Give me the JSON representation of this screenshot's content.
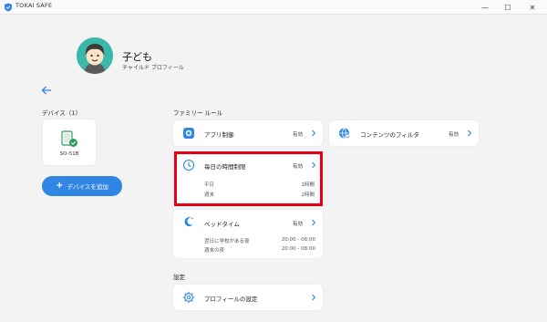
{
  "window": {
    "app_title": "TOKAI SAFE",
    "minimize": "—",
    "maximize": "☐",
    "close": "✕"
  },
  "profile": {
    "name": "子ども",
    "type": "チャイルド プロフィール"
  },
  "devices": {
    "heading": "デバイス（1）",
    "items": [
      {
        "name": "SO-51B"
      }
    ],
    "add_button": "デバイスを追加"
  },
  "family_rules": {
    "heading": "ファミリー ルール",
    "app_control": {
      "label": "アプリ制御",
      "status": "有効"
    },
    "content_filter": {
      "label": "コンテンツのフィルタ",
      "status": "有効"
    },
    "daily_time_limit": {
      "label": "毎日の時間制限",
      "status": "有効",
      "rows": [
        {
          "label": "平日",
          "value": "1時間"
        },
        {
          "label": "週末",
          "value": "2時間"
        }
      ]
    },
    "bedtime": {
      "label": "ベッドタイム",
      "status": "有効",
      "rows": [
        {
          "label": "翌日に学校がある夜",
          "value": "20:00 - 08:00"
        },
        {
          "label": "週末の夜",
          "value": "20:00 - 08:00"
        }
      ]
    }
  },
  "settings": {
    "heading": "設定",
    "profile_settings": {
      "label": "プロフィールの設定"
    }
  },
  "colors": {
    "accent": "#2f86e3",
    "highlight": "#e60012",
    "avatar_bg": "#3bb8aa"
  }
}
